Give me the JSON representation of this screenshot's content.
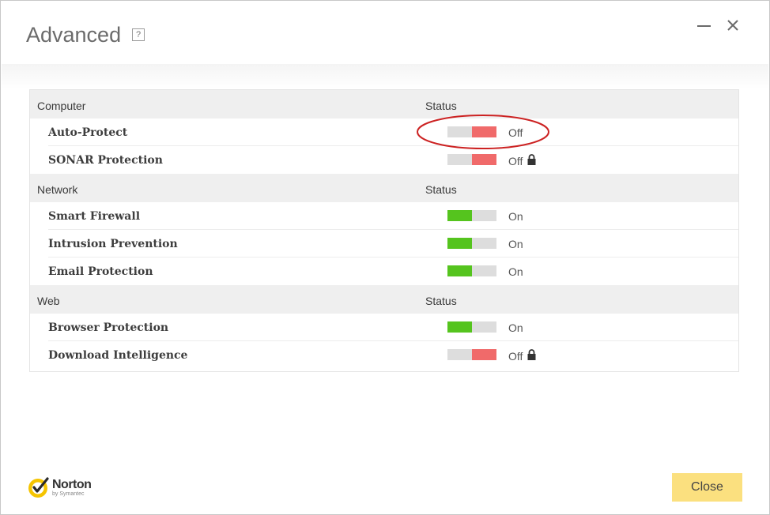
{
  "window": {
    "title": "Advanced",
    "help_label": "?",
    "minimize_icon": "minimize-icon",
    "close_icon": "close-icon"
  },
  "sections": [
    {
      "name": "Computer",
      "status_header": "Status",
      "items": [
        {
          "label": "Auto-Protect",
          "state": "Off",
          "on": false,
          "locked": false
        },
        {
          "label": "SONAR Protection",
          "state": "Off",
          "on": false,
          "locked": true
        }
      ]
    },
    {
      "name": "Network",
      "status_header": "Status",
      "items": [
        {
          "label": "Smart Firewall",
          "state": "On",
          "on": true,
          "locked": false
        },
        {
          "label": "Intrusion Prevention",
          "state": "On",
          "on": true,
          "locked": false
        },
        {
          "label": "Email Protection",
          "state": "On",
          "on": true,
          "locked": false
        }
      ]
    },
    {
      "name": "Web",
      "status_header": "Status",
      "items": [
        {
          "label": "Browser Protection",
          "state": "On",
          "on": true,
          "locked": false
        },
        {
          "label": "Download Intelligence",
          "state": "Off",
          "on": false,
          "locked": true
        }
      ]
    }
  ],
  "footer": {
    "logo_name": "Norton",
    "logo_sub": "by Symantec",
    "close_label": "Close"
  },
  "colors": {
    "toggle_on": "#55c41e",
    "toggle_off": "#f06a6a",
    "toggle_track": "#dddddd",
    "close_button": "#fbe07f",
    "annotation": "#cc2222"
  }
}
